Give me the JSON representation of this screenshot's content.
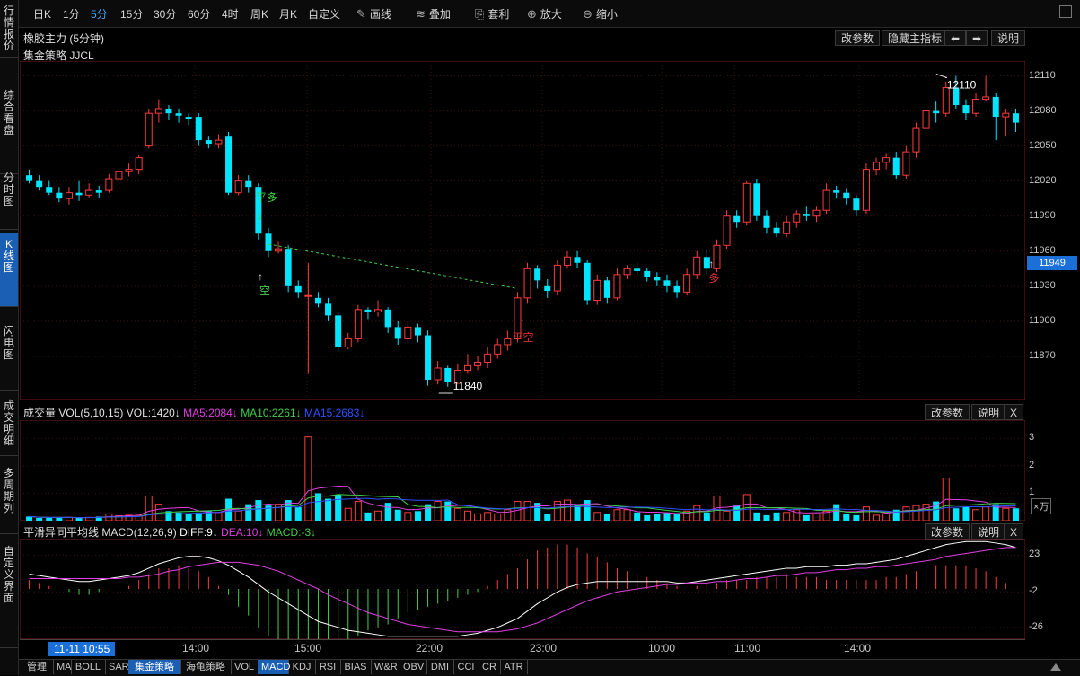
{
  "left_nav": [
    {
      "label": "行情报价",
      "active": false
    },
    {
      "label": "综合看盘",
      "active": false
    },
    {
      "label": "分时图",
      "active": false
    },
    {
      "label": "K线图",
      "active": true
    },
    {
      "label": "闪电图",
      "active": false
    },
    {
      "label": "成交明细",
      "active": false
    },
    {
      "label": "多周期列",
      "active": false
    },
    {
      "label": "自定义界面",
      "active": false
    }
  ],
  "toolbar": {
    "periods": [
      "日K",
      "1分",
      "5分",
      "15分",
      "30分",
      "60分",
      "4时",
      "周K",
      "月K",
      "自定义"
    ],
    "active_period": "5分",
    "tools": [
      {
        "label": "画线",
        "icon": "pencil-icon"
      },
      {
        "label": "叠加",
        "icon": "stack-icon"
      },
      {
        "label": "套利",
        "icon": "arbitrage-icon"
      },
      {
        "label": "放大",
        "icon": "zoom-in-icon"
      },
      {
        "label": "缩小",
        "icon": "zoom-out-icon"
      }
    ]
  },
  "main_panel": {
    "title": "橡胶主力 (5分钟)",
    "strategy": "集金策略 JJCL",
    "buttons": [
      "改参数",
      "隐藏主指标",
      "说明"
    ],
    "y_labels": [
      "12110",
      "12080",
      "12050",
      "12020",
      "11990",
      "11960",
      "11930",
      "11900",
      "11870"
    ],
    "current_price": "11949",
    "high_label": "12110",
    "low_label": "11840",
    "signals": [
      {
        "text": "平多",
        "color": "#3ed04a"
      },
      {
        "text": "空",
        "color": "#3ed04a"
      },
      {
        "text": "平空",
        "color": "#e03030"
      },
      {
        "text": "多",
        "color": "#e03030"
      }
    ]
  },
  "volume_panel": {
    "name": "成交量",
    "params": "VOL(5,10,15)",
    "vol": "VOL:1420↓",
    "ma5": "MA5:2084↓",
    "ma10": "MA10:2261↓",
    "ma15": "MA15:2683↓",
    "buttons": [
      "改参数",
      "说明",
      "X"
    ],
    "y_labels": [
      "3",
      "2",
      "1"
    ],
    "unit": "×万",
    "colors": {
      "ma5": "#e040e0",
      "ma10": "#3ed04a",
      "ma15": "#3050ff"
    }
  },
  "macd_panel": {
    "name": "平滑异同平均线",
    "params": "MACD(12,26,9)",
    "diff": "DIFF:9↓",
    "dea": "DEA:10↓",
    "macd": "MACD:-3↓",
    "buttons": [
      "改参数",
      "说明",
      "X"
    ],
    "y_labels": [
      "23",
      "-2",
      "-26"
    ],
    "colors": {
      "diff": "#ffffff",
      "dea": "#e040e0",
      "macd": "#3ed04a"
    }
  },
  "time_axis": {
    "cursor": "11-11 10:55",
    "labels": [
      "14:00",
      "15:00",
      "22:00",
      "23:00",
      "10:00",
      "11:00",
      "14:00"
    ]
  },
  "bottom_tabs": [
    "管理",
    "MA",
    "BOLL",
    "SAR",
    "集金策略",
    "海龟策略",
    "VOL",
    "MACD",
    "KDJ",
    "RSI",
    "BIAS",
    "W&R",
    "OBV",
    "DMI",
    "CCI",
    "CR",
    "ATR"
  ],
  "active_tabs": [
    "集金策略",
    "MACD"
  ],
  "chart_data": {
    "type": "candlestick",
    "ylim": [
      11840,
      12115
    ],
    "candles": [
      [
        12025,
        12020,
        12030,
        12018
      ],
      [
        12020,
        12015,
        12025,
        12012
      ],
      [
        12015,
        12010,
        12020,
        12008
      ],
      [
        12010,
        12005,
        12015,
        12002
      ],
      [
        12005,
        12010,
        12015,
        12000
      ],
      [
        12010,
        12008,
        12020,
        12003
      ],
      [
        12008,
        12012,
        12018,
        12006
      ],
      [
        12012,
        12010,
        12016,
        12006
      ],
      [
        12012,
        12022,
        12026,
        12010
      ],
      [
        12022,
        12028,
        12030,
        12020
      ],
      [
        12028,
        12030,
        12035,
        12024
      ],
      [
        12030,
        12040,
        12042,
        12026
      ],
      [
        12050,
        12078,
        12082,
        12048
      ],
      [
        12078,
        12082,
        12090,
        12070
      ],
      [
        12082,
        12078,
        12085,
        12072
      ],
      [
        12078,
        12076,
        12082,
        12070
      ],
      [
        12075,
        12073,
        12078,
        12068
      ],
      [
        12075,
        12055,
        12078,
        12050
      ],
      [
        12055,
        12052,
        12058,
        12048
      ],
      [
        12052,
        12055,
        12060,
        12048
      ],
      [
        12058,
        12010,
        12062,
        12008
      ],
      [
        12010,
        12020,
        12025,
        12008
      ],
      [
        12020,
        12015,
        12025,
        12010
      ],
      [
        12015,
        11975,
        12018,
        11970
      ],
      [
        11975,
        11960,
        11980,
        11955
      ],
      [
        11960,
        11962,
        11968,
        11958
      ],
      [
        11962,
        11930,
        11965,
        11925
      ],
      [
        11930,
        11925,
        11935,
        11920
      ],
      [
        11922,
        11922,
        11950,
        11855
      ],
      [
        11920,
        11915,
        11925,
        11912
      ],
      [
        11915,
        11905,
        11920,
        11900
      ],
      [
        11905,
        11878,
        11908,
        11874
      ],
      [
        11878,
        11885,
        11890,
        11876
      ],
      [
        11885,
        11910,
        11914,
        11882
      ],
      [
        11910,
        11908,
        11912,
        11902
      ],
      [
        11908,
        11910,
        11918,
        11904
      ],
      [
        11910,
        11895,
        11912,
        11890
      ],
      [
        11895,
        11885,
        11900,
        11880
      ],
      [
        11885,
        11895,
        11900,
        11882
      ],
      [
        11895,
        11888,
        11898,
        11882
      ],
      [
        11888,
        11850,
        11892,
        11845
      ],
      [
        11850,
        11860,
        11866,
        11846
      ],
      [
        11860,
        11848,
        11862,
        11844
      ],
      [
        11848,
        11858,
        11864,
        11846
      ],
      [
        11858,
        11862,
        11872,
        11855
      ],
      [
        11862,
        11865,
        11870,
        11858
      ],
      [
        11865,
        11872,
        11878,
        11860
      ],
      [
        11872,
        11880,
        11885,
        11868
      ],
      [
        11880,
        11885,
        11892,
        11875
      ],
      [
        11885,
        11920,
        11925,
        11882
      ],
      [
        11920,
        11945,
        11950,
        11915
      ],
      [
        11945,
        11935,
        11948,
        11928
      ],
      [
        11930,
        11926,
        11936,
        11920
      ],
      [
        11926,
        11948,
        11952,
        11922
      ],
      [
        11948,
        11955,
        11960,
        11945
      ],
      [
        11955,
        11950,
        11960,
        11946
      ],
      [
        11950,
        11918,
        11952,
        11914
      ],
      [
        11918,
        11935,
        11940,
        11914
      ],
      [
        11935,
        11920,
        11938,
        11915
      ],
      [
        11920,
        11940,
        11945,
        11918
      ],
      [
        11940,
        11945,
        11948,
        11936
      ],
      [
        11945,
        11943,
        11950,
        11940
      ],
      [
        11943,
        11938,
        11946,
        11934
      ],
      [
        11938,
        11935,
        11942,
        11930
      ],
      [
        11935,
        11930,
        11940,
        11925
      ],
      [
        11930,
        11925,
        11935,
        11920
      ],
      [
        11925,
        11940,
        11945,
        11922
      ],
      [
        11940,
        11955,
        11960,
        11936
      ],
      [
        11955,
        11945,
        11962,
        11940
      ],
      [
        11945,
        11965,
        11970,
        11942
      ],
      [
        11965,
        11990,
        11995,
        11962
      ],
      [
        11990,
        11985,
        11995,
        11980
      ],
      [
        11985,
        12018,
        12020,
        11982
      ],
      [
        12018,
        11990,
        12022,
        11986
      ],
      [
        11990,
        11980,
        11995,
        11975
      ],
      [
        11980,
        11975,
        11985,
        11972
      ],
      [
        11975,
        11985,
        11990,
        11972
      ],
      [
        11985,
        11992,
        11995,
        11980
      ],
      [
        11992,
        11990,
        11998,
        11986
      ],
      [
        11990,
        11995,
        11998,
        11985
      ],
      [
        11995,
        12012,
        12018,
        11992
      ],
      [
        12012,
        12010,
        12016,
        12005
      ],
      [
        12010,
        12005,
        12014,
        12000
      ],
      [
        12005,
        11995,
        12008,
        11990
      ],
      [
        11995,
        12030,
        12035,
        11992
      ],
      [
        12030,
        12036,
        12040,
        12025
      ],
      [
        12036,
        12040,
        12044,
        12030
      ],
      [
        12040,
        12025,
        12045,
        12022
      ],
      [
        12025,
        12045,
        12050,
        12022
      ],
      [
        12045,
        12065,
        12070,
        12040
      ],
      [
        12065,
        12080,
        12085,
        12060
      ],
      [
        12080,
        12078,
        12088,
        12070
      ],
      [
        12078,
        12100,
        12105,
        12075
      ],
      [
        12100,
        12085,
        12110,
        12082
      ],
      [
        12085,
        12078,
        12090,
        12072
      ],
      [
        12078,
        12090,
        12095,
        12075
      ],
      [
        12090,
        12092,
        12110,
        12088
      ],
      [
        12092,
        12075,
        12095,
        12055
      ],
      [
        12075,
        12078,
        12082,
        12058
      ],
      [
        12078,
        12070,
        12082,
        12062
      ]
    ],
    "volume": [
      0.15,
      0.1,
      0.1,
      0.12,
      0.12,
      0.1,
      0.12,
      0.15,
      0.25,
      0.18,
      0.2,
      0.2,
      0.9,
      0.6,
      0.35,
      0.3,
      0.25,
      0.3,
      0.35,
      0.3,
      0.8,
      0.35,
      0.6,
      0.75,
      0.55,
      0.6,
      0.75,
      0.5,
      3.05,
      1.0,
      0.8,
      0.95,
      0.45,
      0.7,
      0.3,
      0.35,
      0.65,
      0.4,
      0.3,
      0.35,
      0.6,
      0.7,
      0.7,
      0.45,
      0.35,
      0.25,
      0.3,
      0.25,
      0.4,
      0.7,
      0.7,
      0.65,
      0.25,
      0.7,
      0.75,
      0.6,
      0.75,
      0.3,
      0.25,
      0.4,
      0.4,
      0.3,
      0.2,
      0.25,
      0.3,
      0.25,
      0.35,
      0.55,
      0.3,
      0.9,
      0.35,
      0.55,
      0.95,
      0.3,
      0.2,
      0.3,
      0.3,
      0.4,
      0.2,
      0.25,
      0.35,
      0.6,
      0.25,
      0.2,
      0.5,
      0.2,
      0.25,
      0.4,
      0.5,
      0.55,
      0.6,
      0.7,
      1.55,
      0.45,
      0.5,
      0.4,
      0.5,
      0.6,
      0.45,
      0.45
    ],
    "macd_diff": [
      10,
      9,
      8,
      7,
      6,
      5,
      5,
      6,
      7,
      8,
      9,
      11,
      14,
      17,
      19,
      21,
      22,
      22,
      21,
      19,
      16,
      12,
      8,
      3,
      -2,
      -6,
      -10,
      -14,
      -18,
      -22,
      -24,
      -26,
      -28,
      -29,
      -30,
      -31,
      -32,
      -32,
      -32,
      -32,
      -32,
      -32,
      -32,
      -32,
      -31,
      -30,
      -28,
      -26,
      -23,
      -20,
      -15,
      -10,
      -6,
      -2,
      1,
      3,
      4,
      5,
      5,
      5,
      5,
      5,
      5,
      5,
      5,
      4,
      4,
      5,
      6,
      7,
      8,
      9,
      10,
      11,
      12,
      13,
      14,
      14,
      15,
      15,
      15,
      16,
      16,
      17,
      17,
      18,
      19,
      20,
      22,
      24,
      26,
      28,
      30,
      31,
      32,
      32,
      32,
      31,
      30,
      28
    ],
    "macd_dea": [
      7,
      7,
      7,
      7,
      7,
      7,
      7,
      7,
      7,
      7,
      8,
      8,
      9,
      10,
      12,
      13,
      15,
      16,
      17,
      18,
      18,
      18,
      17,
      16,
      14,
      12,
      9,
      6,
      3,
      0,
      -4,
      -7,
      -10,
      -13,
      -16,
      -18,
      -20,
      -22,
      -24,
      -25,
      -26,
      -27,
      -28,
      -29,
      -29,
      -29,
      -29,
      -29,
      -28,
      -27,
      -25,
      -23,
      -20,
      -17,
      -14,
      -11,
      -8,
      -6,
      -4,
      -2,
      -1,
      0,
      1,
      2,
      3,
      3,
      4,
      4,
      4,
      5,
      5,
      6,
      7,
      7,
      8,
      9,
      9,
      10,
      11,
      11,
      12,
      13,
      13,
      14,
      14,
      15,
      15,
      16,
      17,
      18,
      19,
      20,
      22,
      23,
      24,
      25,
      26,
      27,
      28,
      28
    ]
  }
}
